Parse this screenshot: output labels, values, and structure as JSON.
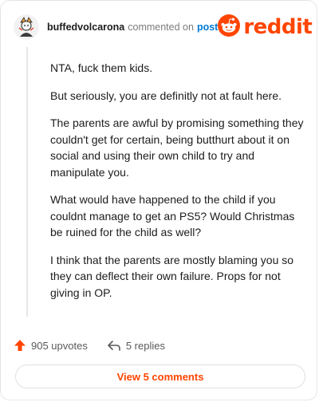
{
  "comment": {
    "username": "buffedvolcarona",
    "meta_text": "commented on",
    "post_link": "post",
    "paragraphs": [
      "NTA, fuck them kids.",
      "But seriously, you are definitly not at fault here.",
      "The parents are awful by promising something they couldn't get for certain, being butthurt about it on social and using their own child to try and manipulate you.",
      "What would have happened to the child if you couldnt manage to get an PS5? Would Christmas be ruined for the child as well?",
      "I think that the parents are mostly blaming you so they can deflect their own failure. Props for not giving in OP."
    ]
  },
  "brand": {
    "wordmark": "reddit",
    "color": "#ff4500",
    "icon": "reddit-snoo-icon"
  },
  "actions": {
    "upvotes_label": "905 upvotes",
    "replies_label": "5 replies",
    "upvote_icon": "upvote-arrow-icon",
    "reply_icon": "reply-arrow-icon"
  },
  "footer": {
    "view_comments_label": "View 5 comments"
  },
  "colors": {
    "accent": "#ff4500",
    "link": "#0079d3",
    "muted": "#7c7c7c"
  }
}
